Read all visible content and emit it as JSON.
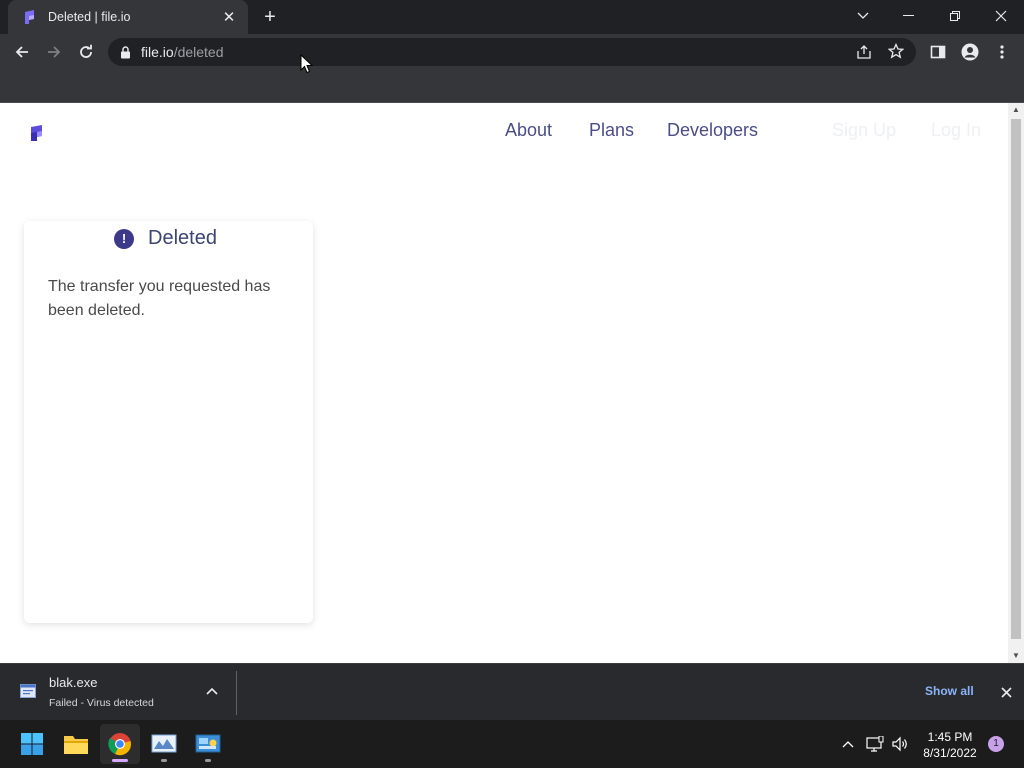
{
  "browser": {
    "tab_title": "Deleted | file.io",
    "url_host": "file.io",
    "url_path": "/deleted"
  },
  "site": {
    "nav": [
      {
        "label": "About"
      },
      {
        "label": "Plans"
      },
      {
        "label": "Developers"
      },
      {
        "label": "Sign Up"
      },
      {
        "label": "Log In"
      }
    ],
    "card": {
      "icon_glyph": "!",
      "title": "Deleted",
      "message": "The transfer you requested has been deleted."
    }
  },
  "download_shelf": {
    "file_name": "blak.exe",
    "status": "Failed - Virus detected",
    "show_all": "Show all"
  },
  "taskbar": {
    "time": "1:45 PM",
    "date": "8/31/2022",
    "notification_count": "1"
  },
  "colors": {
    "accent": "#3d3a8c",
    "nav_text": "#4a4e85",
    "link_blue": "#8ab4f8"
  }
}
